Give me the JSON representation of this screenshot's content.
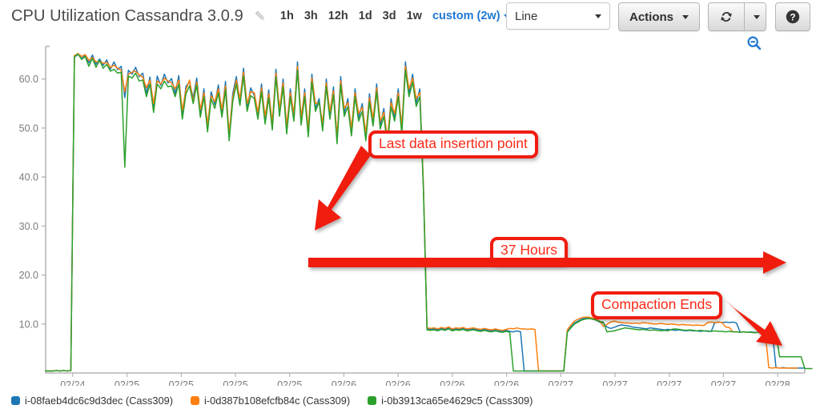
{
  "header": {
    "title": "CPU Utilization Cassandra 3.0.9",
    "edit_icon": "pencil-icon",
    "ranges": [
      "1h",
      "3h",
      "12h",
      "1d",
      "3d",
      "1w"
    ],
    "custom_range": "custom (2w)",
    "chart_type": "Line",
    "actions_label": "Actions",
    "refresh_icon": "refresh-icon",
    "help_icon": "question-mark-icon",
    "zoom_out_icon": "zoom-out-icon"
  },
  "colors": {
    "series_blue": "#1f77b4",
    "series_orange": "#ff7f0e",
    "series_green": "#2ca02c",
    "annotation_red": "#fb2a18",
    "annotation_border": "#f01c10",
    "axis_grey": "#b6b6b6",
    "tick_text": "#7a7a7a",
    "link_blue": "#1f77d0"
  },
  "annotations": [
    {
      "id": "anno-last",
      "text": "Last data insertion point"
    },
    {
      "id": "anno-hours",
      "text": "37 Hours"
    },
    {
      "id": "anno-compact",
      "text": "Compaction Ends"
    }
  ],
  "legend": [
    {
      "color": "#1f77b4",
      "label": "i-08faeb4dc6c9d3dec (Cass309)"
    },
    {
      "color": "#ff7f0e",
      "label": "i-0d387b108efcfb84c (Cass309)"
    },
    {
      "color": "#2ca02c",
      "label": "i-0b3913ca65e4629c5 (Cass309)"
    }
  ],
  "chart_data": {
    "type": "line",
    "title": "CPU Utilization Cassandra 3.0.9",
    "xlabel": "",
    "ylabel": "",
    "ylim": [
      0,
      66
    ],
    "yticks": [
      10.0,
      20.0,
      30.0,
      40.0,
      50.0,
      60.0
    ],
    "ytick_labels": [
      "10.0",
      "20.0",
      "30.0",
      "40.0",
      "50.0",
      "60.0"
    ],
    "grid": false,
    "legend_position": "bottom",
    "xticks": [
      "02/24",
      "02/25",
      "02/25",
      "02/25",
      "02/25",
      "02/26",
      "02/26",
      "02/26",
      "02/26",
      "02/27",
      "02/27",
      "02/27",
      "02/27",
      "02/28"
    ],
    "x_range": [
      "02/24",
      "02/28"
    ],
    "series": [
      {
        "name": "i-08faeb4dc6c9d3dec (Cass309)",
        "color": "#1f77b4",
        "values": [
          0.4,
          0.4,
          0.4,
          0.5,
          0.4,
          0.5,
          0.4,
          0.5,
          64.5,
          65.0,
          64.2,
          64.8,
          63.3,
          64.9,
          63.0,
          64.1,
          62.8,
          63.9,
          62.0,
          63.5,
          61.9,
          62.6,
          56.2,
          61.8,
          61.0,
          62.4,
          60.5,
          61.2,
          57.0,
          60.4,
          54.0,
          60.6,
          58.7,
          61.0,
          59.2,
          60.1,
          57.0,
          60.7,
          52.5,
          58.5,
          59.4,
          56.1,
          60.2,
          52.8,
          58.0,
          49.9,
          57.4,
          54.8,
          58.8,
          53.0,
          59.5,
          48.0,
          57.0,
          60.5,
          55.4,
          62.2,
          54.0,
          58.2,
          56.6,
          52.4,
          59.0,
          51.5,
          57.8,
          50.2,
          62.0,
          53.0,
          60.0,
          49.5,
          58.0,
          52.0,
          63.5,
          51.2,
          58.0,
          48.9,
          61.0,
          54.0,
          56.0,
          50.0,
          60.0,
          52.5,
          58.4,
          47.5,
          60.5,
          53.0,
          56.0,
          49.0,
          58.0,
          52.0,
          55.0,
          48.0,
          57.0,
          51.0,
          59.0,
          50.5,
          54.0,
          47.0,
          56.0,
          52.0,
          58.0,
          49.5,
          63.5,
          57.0,
          61.0,
          55.0,
          58.0,
          38.0,
          9.0,
          8.9,
          9.0,
          8.8,
          9.1,
          8.9,
          9.2,
          8.8,
          9.0,
          8.9,
          9.1,
          8.8,
          8.9,
          9.0,
          8.8,
          8.7,
          8.9,
          8.7,
          8.6,
          8.8,
          8.6,
          8.5,
          8.7,
          8.5,
          8.4,
          8.6,
          8.4,
          0.4,
          0.4,
          0.4,
          0.4,
          0.4,
          0.4,
          0.4,
          0.4,
          0.4,
          0.4,
          0.4,
          0.4,
          8.5,
          9.4,
          10.2,
          10.6,
          11.0,
          11.2,
          11.3,
          11.0,
          10.8,
          10.4,
          10.2,
          9.4,
          9.1,
          9.3,
          9.6,
          9.8,
          9.7,
          9.6,
          9.4,
          9.3,
          9.2,
          9.1,
          9.0,
          9.2,
          9.1,
          9.0,
          8.9,
          8.8,
          8.9,
          8.8,
          8.7,
          8.8,
          8.7,
          8.6,
          8.7,
          8.6,
          8.6,
          8.5,
          8.6,
          8.5,
          8.5,
          10.3,
          10.4,
          10.3,
          10.4,
          10.3,
          10.4,
          10.2,
          8.4,
          8.4,
          8.3,
          8.4,
          8.3,
          8.3,
          8.2,
          8.3,
          8.2,
          8.2,
          1.1,
          1.0,
          1.1,
          1.0,
          1.0,
          1.0,
          1.0,
          1.0,
          1.0
        ]
      },
      {
        "name": "i-0d387b108efcfb84c (Cass309)",
        "color": "#ff7f0e",
        "values": [
          0.4,
          0.4,
          0.4,
          0.5,
          0.4,
          0.5,
          0.4,
          0.5,
          64.8,
          65.2,
          64.6,
          65.0,
          63.8,
          64.4,
          63.5,
          63.6,
          63.2,
          63.4,
          62.4,
          62.8,
          62.2,
          61.8,
          57.4,
          61.0,
          61.4,
          61.6,
          60.8,
          60.4,
          58.2,
          59.8,
          55.0,
          59.6,
          59.0,
          60.2,
          59.6,
          59.2,
          58.0,
          59.8,
          53.6,
          57.8,
          59.8,
          55.4,
          59.4,
          53.8,
          57.2,
          50.8,
          56.6,
          55.4,
          58.0,
          53.8,
          58.6,
          49.0,
          56.2,
          59.8,
          56.0,
          61.4,
          55.0,
          57.4,
          57.2,
          53.2,
          58.2,
          52.4,
          57.0,
          51.2,
          61.2,
          54.0,
          59.2,
          50.6,
          57.2,
          53.0,
          62.6,
          52.2,
          57.2,
          49.8,
          60.2,
          55.0,
          55.2,
          51.0,
          59.2,
          53.4,
          57.6,
          48.4,
          59.6,
          54.0,
          55.2,
          50.0,
          57.2,
          53.0,
          54.2,
          49.0,
          56.2,
          52.0,
          58.2,
          51.4,
          53.2,
          48.0,
          55.2,
          53.0,
          57.2,
          50.4,
          62.6,
          58.0,
          60.2,
          56.0,
          57.2,
          38.5,
          9.2,
          9.1,
          9.2,
          9.0,
          9.3,
          9.1,
          9.4,
          9.0,
          9.2,
          9.1,
          9.3,
          9.0,
          9.1,
          9.2,
          9.0,
          8.9,
          9.1,
          8.9,
          8.8,
          9.0,
          8.8,
          8.7,
          8.9,
          9.1,
          9.0,
          9.2,
          9.0,
          9.0,
          8.9,
          9.0,
          8.9,
          0.4,
          0.4,
          0.4,
          0.4,
          0.4,
          0.4,
          0.4,
          0.4,
          8.8,
          9.8,
          10.6,
          11.0,
          11.3,
          11.4,
          11.4,
          11.2,
          11.0,
          10.6,
          9.5,
          9.9,
          10.4,
          10.6,
          10.4,
          10.3,
          10.2,
          10.2,
          10.1,
          10.2,
          10.1,
          10.3,
          10.2,
          10.1,
          10.0,
          10.0,
          10.1,
          10.0,
          9.9,
          10.0,
          9.9,
          9.8,
          9.9,
          9.8,
          9.8,
          9.7,
          9.8,
          9.7,
          9.7,
          10.3,
          10.4,
          10.3,
          10.4,
          10.3,
          9.4,
          9.3,
          8.4,
          8.4,
          8.3,
          8.4,
          8.3,
          8.3,
          8.2,
          8.3,
          8.2,
          8.2,
          1.1,
          1.0,
          1.1,
          1.0,
          1.0,
          1.0,
          1.0,
          1.0,
          1.0
        ]
      },
      {
        "name": "i-0b3913ca65e4629c5 (Cass309)",
        "color": "#2ca02c",
        "values": [
          0.4,
          0.4,
          0.4,
          0.5,
          0.4,
          0.5,
          0.4,
          0.5,
          64.6,
          65.1,
          64.0,
          64.6,
          62.6,
          64.2,
          62.4,
          63.8,
          62.2,
          63.0,
          61.6,
          62.0,
          61.2,
          61.4,
          42.0,
          60.6,
          60.2,
          61.2,
          59.6,
          59.8,
          56.4,
          59.0,
          53.2,
          59.0,
          58.0,
          59.6,
          58.4,
          58.6,
          56.4,
          59.0,
          51.8,
          57.0,
          58.6,
          55.0,
          58.8,
          52.2,
          56.4,
          49.2,
          56.0,
          54.0,
          57.2,
          52.2,
          57.8,
          47.4,
          55.4,
          59.0,
          54.6,
          60.6,
          53.4,
          56.6,
          56.0,
          51.8,
          57.4,
          50.8,
          56.2,
          49.6,
          60.4,
          52.4,
          58.4,
          48.8,
          56.4,
          51.4,
          61.8,
          50.6,
          56.4,
          48.2,
          59.4,
          53.4,
          55.4,
          49.4,
          58.4,
          51.8,
          56.8,
          46.8,
          58.8,
          52.4,
          54.4,
          48.4,
          56.4,
          51.4,
          53.4,
          47.4,
          55.4,
          50.4,
          57.4,
          49.8,
          52.4,
          46.4,
          54.4,
          51.4,
          56.4,
          48.8,
          61.8,
          56.4,
          59.4,
          54.4,
          56.4,
          37.4,
          8.8,
          8.7,
          8.8,
          8.6,
          8.9,
          8.7,
          9.0,
          8.6,
          8.8,
          8.7,
          8.9,
          8.6,
          8.7,
          8.8,
          8.6,
          8.5,
          8.7,
          8.5,
          8.4,
          8.6,
          8.4,
          8.3,
          8.5,
          8.3,
          0.4,
          0.4,
          0.4,
          0.4,
          0.4,
          0.4,
          0.4,
          0.4,
          0.4,
          0.4,
          0.4,
          0.4,
          0.4,
          0.4,
          0.4,
          8.3,
          9.2,
          10.0,
          10.4,
          10.8,
          11.0,
          11.1,
          11.0,
          10.8,
          10.5,
          10.4,
          8.4,
          8.5,
          8.6,
          8.8,
          9.0,
          9.2,
          9.1,
          9.0,
          8.9,
          8.8,
          8.9,
          8.8,
          8.7,
          8.8,
          8.7,
          8.6,
          8.7,
          8.6,
          8.9,
          9.0,
          8.9,
          8.8,
          8.7,
          8.8,
          8.7,
          8.6,
          8.7,
          8.6,
          8.6,
          8.5,
          8.6,
          8.5,
          8.5,
          8.4,
          8.5,
          8.4,
          8.4,
          8.3,
          8.4,
          8.3,
          8.3,
          8.2,
          8.3,
          8.2,
          8.2,
          8.1,
          8.2,
          8.1,
          3.3,
          3.3,
          3.3,
          3.3,
          3.3,
          3.3,
          3.3,
          0.9,
          0.9,
          0.9
        ]
      }
    ]
  }
}
